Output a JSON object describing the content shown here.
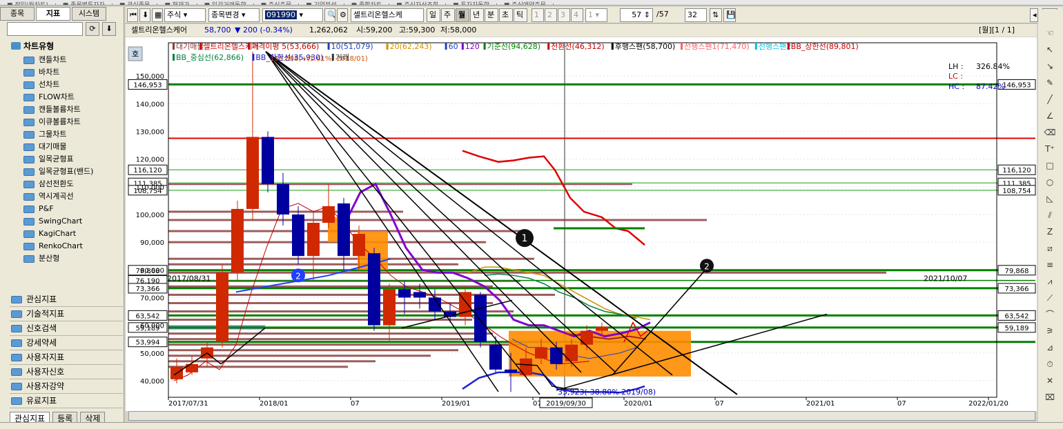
{
  "left": {
    "tabs": [
      "종목",
      "지표",
      "시스템"
    ],
    "tree_header": "차트유형",
    "tree_items": [
      "캔들차트",
      "바차트",
      "선차트",
      "FLOW차트",
      "캔들볼륨차트",
      "이큐볼륨차트",
      "그물차트",
      "대기매물",
      "일목균형표",
      "일목균형표(밴드)",
      "삼선전환도",
      "역시계곡선",
      "P&F",
      "SwingChart",
      "KagiChart",
      "RenkoChart",
      "분산형"
    ],
    "categories": [
      "관심지표",
      "기술적지표",
      "신호검색",
      "강세약세",
      "사용자지표",
      "사용자신호",
      "사용자강약",
      "유료지표"
    ],
    "bottom_tabs": [
      "관심지표",
      "등록",
      "삭제"
    ]
  },
  "toolbar": {
    "market": "주식",
    "change_label": "종목변경",
    "code": "091990",
    "name": "셀트리온헬스케",
    "periods": [
      "일",
      "주",
      "월",
      "년",
      "분",
      "초",
      "틱"
    ],
    "nums": [
      "1",
      "2",
      "3",
      "4",
      "1"
    ],
    "count": "57",
    "total": "/57",
    "zoom": "32"
  },
  "info": {
    "name": "셀트리온헬스케어",
    "price": "58,700",
    "change": "▼ 200 (-0.34%)",
    "volume": "1,262,062",
    "open": "시:59,200",
    "high": "고:59,300",
    "low": "저:58,000",
    "page": "[월][1 / 1]"
  },
  "legend": {
    "row1": [
      {
        "t": "대기매물",
        "c": "#8b3a3a"
      },
      {
        "t": "셀트리온헬스케어",
        "c": "#d00000"
      },
      {
        "t": "가격이평 5(53,666)",
        "c": "#c00000"
      },
      {
        "t": "10(51,079)",
        "c": "#2040c0"
      },
      {
        "t": "20(62,243)",
        "c": "#d09000"
      },
      {
        "t": "60",
        "c": "#2040c0"
      },
      {
        "t": "120",
        "c": "#8000c0"
      },
      {
        "t": "기준선(94,628)",
        "c": "#008000"
      },
      {
        "t": "전환선(46,312)",
        "c": "#c00000"
      },
      {
        "t": "후행스팬(58,700)",
        "c": "#000000"
      },
      {
        "t": "선행스팬1(71,470)",
        "c": "#ff6060"
      },
      {
        "t": "선행스팬2",
        "c": "#00c0e0"
      },
      {
        "t": "BB_상한선(89,801)",
        "c": "#c00000"
      }
    ],
    "row2": [
      {
        "t": "BB_중심선(62,866)",
        "c": "#008040"
      },
      {
        "t": "BB_하한선(35,930)",
        "c": "#2020c0"
      },
      {
        "t": "거래",
        "c": "#333333"
      }
    ]
  },
  "chart_data": {
    "type": "candlestick",
    "y_ticks": [
      40000,
      50000,
      60000,
      70000,
      80000,
      90000,
      100000,
      110000,
      120000,
      130000,
      140000,
      150000
    ],
    "y_tick_labels": [
      "40,000",
      "50,000",
      "60,000",
      "70,000",
      "80,000",
      "90,000",
      "100,000",
      "110,000",
      "120,000",
      "130,000",
      "140,000",
      "150,000"
    ],
    "ylim": [
      34000,
      162000
    ],
    "x_labels": [
      "2017/07/31",
      "2018/01",
      "07",
      "2019/01",
      "07",
      "2020/01",
      "07",
      "2021/01",
      "07",
      "2022/01/20"
    ],
    "cursor_label": "2019/09/30",
    "max_label": "158,808(+(1.61%) 2018/01)",
    "min_label": "35,923(-38.80% 2019/08)",
    "note_left": "2017/08/31",
    "note_right": "2021/10/07",
    "lh": "326.84%",
    "lc": "LC :",
    "hc_label": "HC :",
    "hc": "87.42%",
    "lh_label": "LH :",
    "badge1": "1",
    "badge2": "2",
    "badge_left": "2",
    "hlines_left": [
      "146,953",
      "116,120",
      "111,385",
      "108,754",
      "79,868",
      "76,190",
      "73,366",
      "63,542",
      "59,189",
      "53,994"
    ],
    "hlines_right": [
      "146,953",
      "116,120",
      "111,385",
      "108,754",
      "79,868",
      "73,366",
      "63,542",
      "59,189"
    ],
    "hlines_values": [
      146953,
      116120,
      111385,
      108754,
      79868,
      76190,
      73366,
      63542,
      59189,
      53994
    ],
    "candles": [
      {
        "o": 40500,
        "c": 45000,
        "h": 48000,
        "l": 39000
      },
      {
        "o": 43000,
        "c": 46000,
        "h": 49000,
        "l": 42000
      },
      {
        "o": 48000,
        "c": 52000,
        "h": 54000,
        "l": 45000
      },
      {
        "o": 54000,
        "c": 79000,
        "h": 82000,
        "l": 52000
      },
      {
        "o": 79000,
        "c": 102000,
        "h": 105000,
        "l": 76000
      },
      {
        "o": 102000,
        "c": 128000,
        "h": 158808,
        "l": 98000
      },
      {
        "o": 128000,
        "c": 111000,
        "h": 130000,
        "l": 108000
      },
      {
        "o": 111000,
        "c": 100000,
        "h": 115000,
        "l": 96000
      },
      {
        "o": 100000,
        "c": 85000,
        "h": 103000,
        "l": 82000
      },
      {
        "o": 85000,
        "c": 97000,
        "h": 101000,
        "l": 76000
      },
      {
        "o": 97000,
        "c": 103000,
        "h": 111000,
        "l": 95000
      },
      {
        "o": 104000,
        "c": 85000,
        "h": 106000,
        "l": 80000
      },
      {
        "o": 85000,
        "c": 93000,
        "h": 96000,
        "l": 80000
      },
      {
        "o": 86000,
        "c": 60000,
        "h": 88000,
        "l": 58000
      },
      {
        "o": 60000,
        "c": 73000,
        "h": 75000,
        "l": 54000
      },
      {
        "o": 73000,
        "c": 70000,
        "h": 76000,
        "l": 64000
      },
      {
        "o": 72000,
        "c": 70000,
        "h": 75000,
        "l": 66000
      },
      {
        "o": 70000,
        "c": 65000,
        "h": 73000,
        "l": 62000
      },
      {
        "o": 65000,
        "c": 63000,
        "h": 68000,
        "l": 61000
      },
      {
        "o": 63000,
        "c": 72000,
        "h": 74000,
        "l": 60000
      },
      {
        "o": 71000,
        "c": 54000,
        "h": 72000,
        "l": 52000
      },
      {
        "o": 53000,
        "c": 44000,
        "h": 56000,
        "l": 43000
      },
      {
        "o": 44000,
        "c": 43000,
        "h": 50000,
        "l": 35923
      },
      {
        "o": 42000,
        "c": 48000,
        "h": 52000,
        "l": 41000
      },
      {
        "o": 48000,
        "c": 52000,
        "h": 55000,
        "l": 46000
      },
      {
        "o": 52000,
        "c": 46000,
        "h": 54000,
        "l": 44000
      },
      {
        "o": 47000,
        "c": 53000,
        "h": 55000,
        "l": 45000
      },
      {
        "o": 53000,
        "c": 58000,
        "h": 60000,
        "l": 51000
      },
      {
        "o": 58000,
        "c": 59500,
        "h": 61000,
        "l": 56000
      }
    ]
  }
}
